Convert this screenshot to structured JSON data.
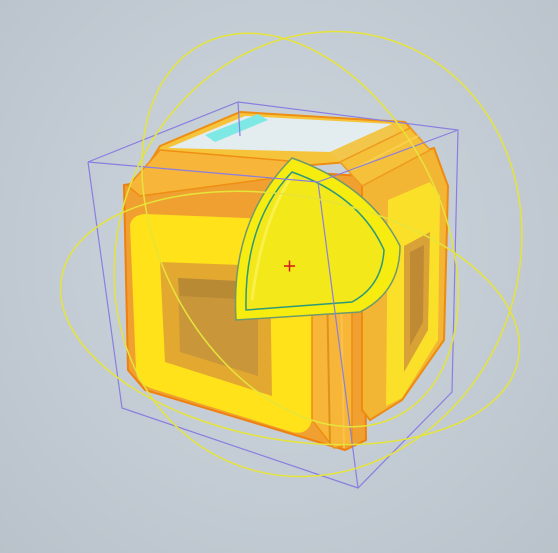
{
  "viewport": {
    "background": "#c7d0d8",
    "object": "cube-frame-with-rounded-corner-piece",
    "colors": {
      "cube_face_light": "#ffe21a",
      "cube_face_mid": "#f6c72a",
      "cube_face_orange": "#f0a030",
      "cube_edge_orange": "#f08a10",
      "corner_selected": "#f4ee10",
      "cyan_inner": "#7ee8e4",
      "bounding_box": "#8a7ee0",
      "rotate_gizmo": "#e6e43a",
      "pivot": "#d01818"
    },
    "gizmo": {
      "type": "rotate",
      "pivot_icon": "crosshair-icon"
    }
  }
}
